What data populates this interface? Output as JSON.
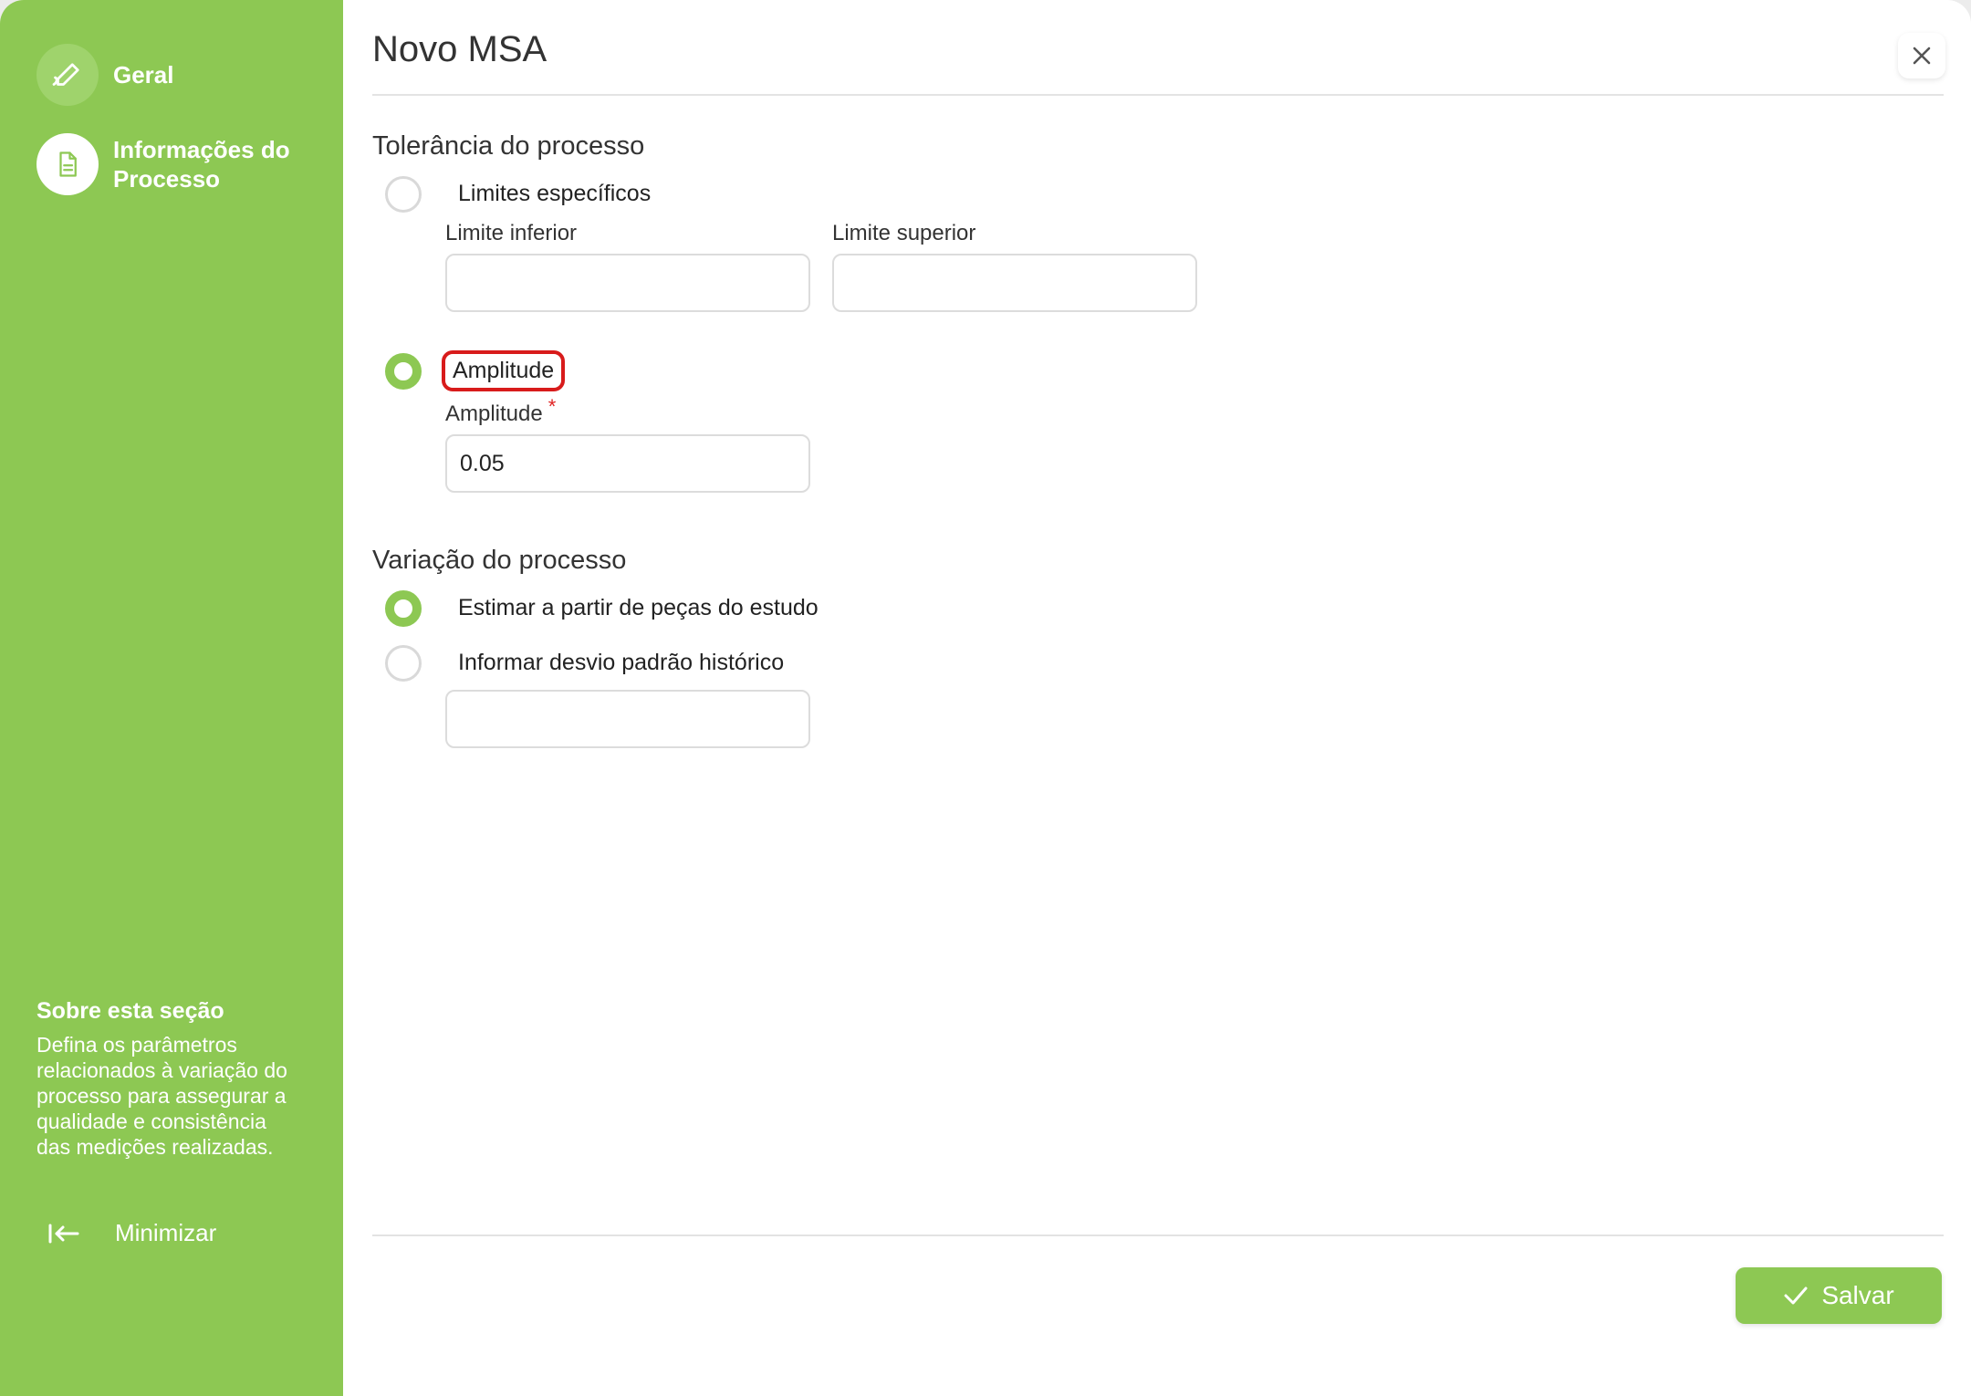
{
  "colors": {
    "sidebar": "#8dc853",
    "accent": "#8dc853",
    "required": "#e02222",
    "highlight": "#d81b1b"
  },
  "sidebar": {
    "steps": [
      {
        "label": "Geral",
        "icon": "pencil-icon",
        "state": "done"
      },
      {
        "label": "Informações do Processo",
        "icon": "document-icon",
        "state": "active"
      }
    ],
    "about": {
      "title": "Sobre esta seção",
      "text": "Defina os parâmetros relacionados à variação do processo para assegurar a qualidade e consistência das medições realizadas."
    },
    "minimize_label": "Minimizar",
    "minimize_icon": "collapse-left-icon"
  },
  "header": {
    "title": "Novo MSA",
    "close_icon": "close-icon"
  },
  "tolerance": {
    "title": "Tolerância do processo",
    "options": [
      {
        "label": "Limites específicos",
        "checked": false
      },
      {
        "label": "Amplitude",
        "checked": true
      }
    ],
    "lower_label": "Limite inferior",
    "lower_value": "",
    "upper_label": "Limite superior",
    "upper_value": "",
    "amplitude_label": "Amplitude",
    "amplitude_required_mark": "*",
    "amplitude_value": "0.05"
  },
  "variation": {
    "title": "Variação do processo",
    "options": [
      {
        "label": "Estimar a partir de peças do estudo",
        "checked": true
      },
      {
        "label": "Informar desvio padrão histórico",
        "checked": false
      }
    ],
    "std_value": ""
  },
  "footer": {
    "save_label": "Salvar",
    "save_icon": "check-icon"
  }
}
